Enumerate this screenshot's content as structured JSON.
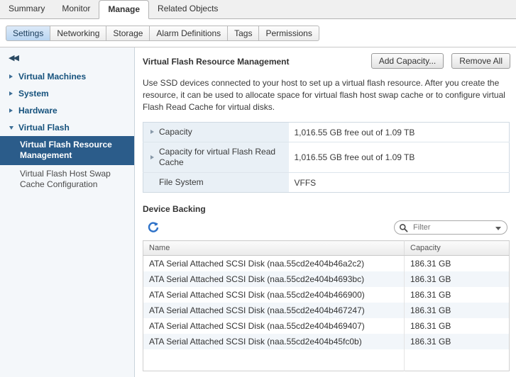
{
  "main_tabs": [
    {
      "label": "Summary",
      "selected": false
    },
    {
      "label": "Monitor",
      "selected": false
    },
    {
      "label": "Manage",
      "selected": true
    },
    {
      "label": "Related Objects",
      "selected": false
    }
  ],
  "sub_tabs": [
    {
      "label": "Settings",
      "selected": true
    },
    {
      "label": "Networking",
      "selected": false
    },
    {
      "label": "Storage",
      "selected": false
    },
    {
      "label": "Alarm Definitions",
      "selected": false
    },
    {
      "label": "Tags",
      "selected": false
    },
    {
      "label": "Permissions",
      "selected": false
    }
  ],
  "sidebar": {
    "collapse_icon": "double-chevron-left",
    "groups": [
      {
        "label": "Virtual Machines",
        "expanded": false
      },
      {
        "label": "System",
        "expanded": false
      },
      {
        "label": "Hardware",
        "expanded": false
      },
      {
        "label": "Virtual Flash",
        "expanded": true
      }
    ],
    "children": [
      {
        "label": "Virtual Flash Resource Management",
        "selected": true
      },
      {
        "label": "Virtual Flash Host Swap Cache Configuration",
        "selected": false
      }
    ]
  },
  "main": {
    "title": "Virtual Flash Resource Management",
    "buttons": {
      "add_capacity": "Add Capacity...",
      "remove_all": "Remove All"
    },
    "description": "Use SSD devices connected to your host to set up a virtual flash resource. After you create the resource, it can be used to allocate space for virtual flash host swap cache or to configure virtual Flash Read Cache for virtual disks.",
    "properties": [
      {
        "key": "Capacity",
        "value": "1,016.55 GB free out of 1.09 TB",
        "expandable": true
      },
      {
        "key": "Capacity for virtual Flash Read Cache",
        "value": "1,016.55 GB free out of 1.09 TB",
        "expandable": true
      },
      {
        "key": "File System",
        "value": "VFFS",
        "expandable": false
      }
    ],
    "device_backing": {
      "title": "Device Backing",
      "refresh_icon": "refresh-icon",
      "filter": {
        "icon": "search-icon",
        "placeholder": "Filter",
        "value": ""
      },
      "columns": [
        "Name",
        "Capacity"
      ],
      "rows": [
        {
          "name": "ATA Serial Attached SCSI Disk (naa.55cd2e404b46a2c2)",
          "capacity": "186.31 GB"
        },
        {
          "name": "ATA Serial Attached SCSI Disk (naa.55cd2e404b4693bc)",
          "capacity": "186.31 GB"
        },
        {
          "name": "ATA Serial Attached SCSI Disk (naa.55cd2e404b466900)",
          "capacity": "186.31 GB"
        },
        {
          "name": "ATA Serial Attached SCSI Disk (naa.55cd2e404b467247)",
          "capacity": "186.31 GB"
        },
        {
          "name": "ATA Serial Attached SCSI Disk (naa.55cd2e404b469407)",
          "capacity": "186.31 GB"
        },
        {
          "name": "ATA Serial Attached SCSI Disk (naa.55cd2e404b45fc0b)",
          "capacity": "186.31 GB"
        }
      ]
    }
  },
  "colors": {
    "selected_nav": "#2b5c8a",
    "nav_text": "#16527d",
    "active_subtab": "#b9d6f2",
    "refresh_blue": "#2e72c8",
    "prop_key_bg": "#e9f0f6",
    "row_alt_bg": "#f2f6fa"
  }
}
